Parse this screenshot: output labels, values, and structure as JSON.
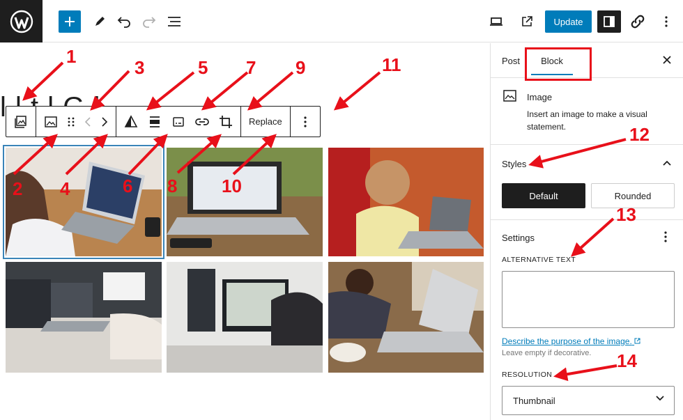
{
  "header": {
    "update_label": "Update",
    "icons": [
      "wordpress-logo-icon",
      "plus-icon",
      "pencil-icon",
      "undo-icon",
      "redo-icon",
      "list-view-icon",
      "desktop-preview-icon",
      "external-link-icon",
      "sidebar-toggle-icon",
      "jetpack-link-icon",
      "kebab-icon"
    ]
  },
  "canvas": {
    "title_fragment": "l  l     t   l  G  l",
    "toolbar": {
      "replace_label": "Replace"
    }
  },
  "sidebar": {
    "tabs": [
      {
        "label": "Post"
      },
      {
        "label": "Block"
      }
    ],
    "block": {
      "name": "Image",
      "description": "Insert an image to make a visual statement."
    },
    "styles": {
      "title": "Styles",
      "default_label": "Default",
      "rounded_label": "Rounded"
    },
    "settings": {
      "title": "Settings",
      "alt_label": "ALTERNATIVE TEXT",
      "alt_value": "",
      "describe_link": "Describe the purpose of the image.",
      "hint": "Leave empty if decorative.",
      "resolution_label": "RESOLUTION",
      "resolution_value": "Thumbnail"
    }
  },
  "annotations": {
    "n1": "1",
    "n2": "2",
    "n3": "3",
    "n4": "4",
    "n5": "5",
    "n6": "6",
    "n7": "7",
    "n8": "8",
    "n9": "9",
    "n10": "10",
    "n11": "11",
    "n12": "12",
    "n13": "13",
    "n14": "14"
  },
  "colors": {
    "accent": "#007cba",
    "annotation": "#e8101a",
    "dark": "#1e1e1e"
  }
}
